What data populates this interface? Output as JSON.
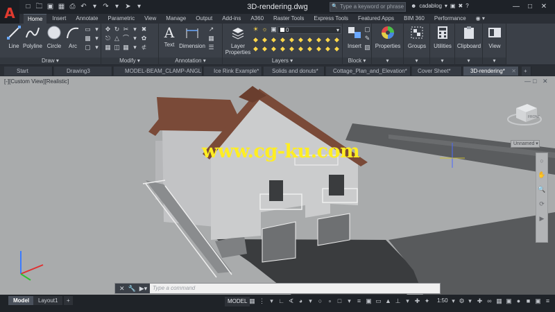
{
  "app": {
    "logo": "A",
    "title": "3D-rendering.dwg",
    "search_placeholder": "Type a keyword or phrase",
    "user": "cadablog",
    "colors": {
      "titlebar": "#1e2228",
      "ribbon": "#3b4048",
      "accent": "#e03a2f",
      "viewport_bg": "#a9abac",
      "roof": "#7a4a38",
      "wall": "#c7c8ca",
      "watermark": "#ffee22"
    }
  },
  "ribbon_tabs": [
    "Home",
    "Insert",
    "Annotate",
    "Parametric",
    "View",
    "Manage",
    "Output",
    "Add-ins",
    "A360",
    "Raster Tools",
    "Express Tools",
    "Featured Apps",
    "BIM 360",
    "Performance"
  ],
  "ribbon": {
    "draw": {
      "label": "Draw",
      "buttons": [
        "Line",
        "Polyline",
        "Circle",
        "Arc"
      ]
    },
    "modify": {
      "label": "Modify"
    },
    "annotation": {
      "label": "Annotation",
      "buttons": [
        "Text",
        "Dimension"
      ]
    },
    "layers": {
      "label": "Layers",
      "properties_button": "Layer Properties",
      "current_layer": "0"
    },
    "block": {
      "label": "Block",
      "insert_button": "Insert"
    },
    "properties": {
      "label": "Properties"
    },
    "groups": {
      "label": "Groups"
    },
    "utilities": {
      "label": "Utilities"
    },
    "clipboard": {
      "label": "Clipboard"
    },
    "view": {
      "label": "View"
    }
  },
  "doc_tabs": [
    "Start",
    "Drawing3",
    "MODEL-BEAM_CLAMP-ANGLE*",
    "Ice Rink Example*",
    "Solids and donuts*",
    "Cottage_Plan_and_Elevation*",
    "Cover Sheet*",
    "3D-rendering*"
  ],
  "viewport": {
    "label": "[-][Custom View][Realistic]",
    "watermark": "www.cg-ku.com",
    "view_name": "Unnamed",
    "viewcube_face": "FRONT"
  },
  "command": {
    "placeholder": "Type a command"
  },
  "status": {
    "layout_tabs": [
      "Model",
      "Layout1"
    ],
    "model_label": "MODEL",
    "scale": "1:50"
  }
}
